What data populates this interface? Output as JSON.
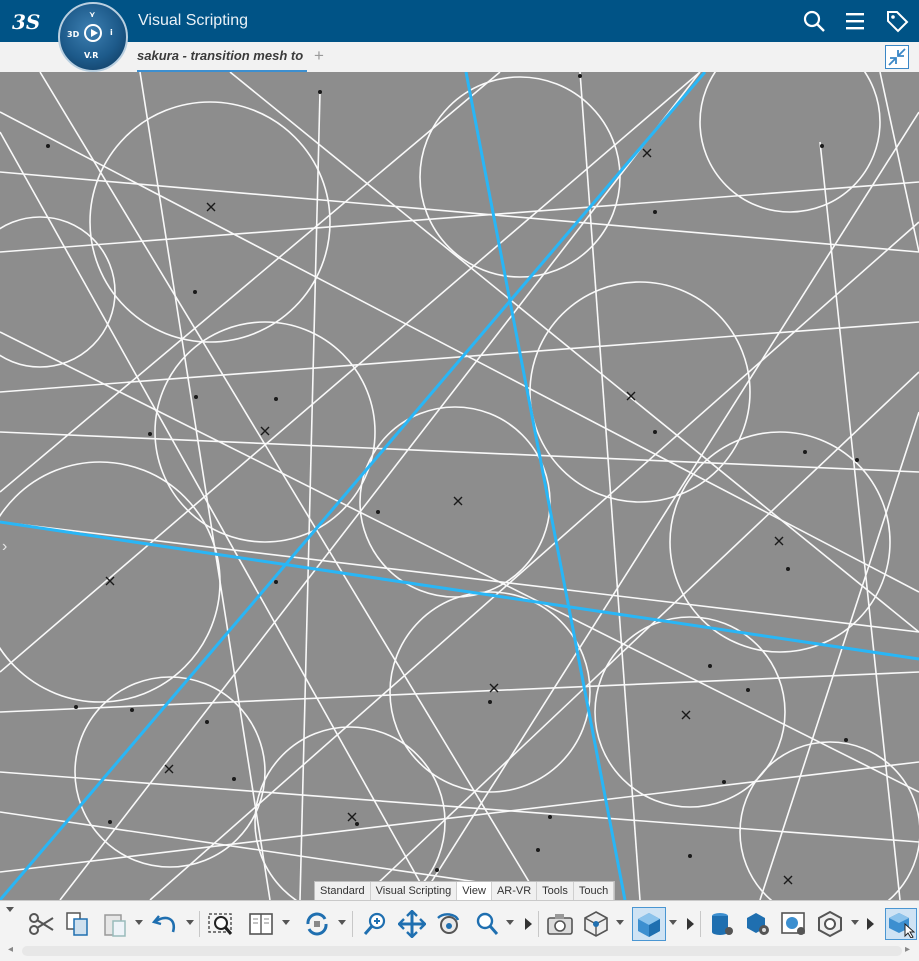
{
  "app": {
    "title": "Visual Scripting",
    "brand_logo": "3DS",
    "compass": {
      "top": "3D",
      "bottom": "V.R",
      "left": "3D",
      "right": "i"
    }
  },
  "header": {
    "icons": [
      "search-icon",
      "menu-icon",
      "tag-icon"
    ]
  },
  "tabs": {
    "document_tab": "sakura - transition mesh to",
    "add_tab": "+"
  },
  "toolbar_tabs": [
    "Standard",
    "Visual Scripting",
    "View",
    "AR-VR",
    "Tools",
    "Touch"
  ],
  "toolbar_active_tab": "View",
  "toolbar_icons": [
    "cut-icon",
    "copy-icon",
    "paste-icon",
    "undo-icon",
    "zoom-fit-icon",
    "book-icon",
    "rotate-icon",
    "zoom-icon",
    "pan-icon",
    "look-at-icon",
    "zoom-in-out-icon",
    "camera-icon",
    "view-cube-icon",
    "shaded-icon",
    "database-icon",
    "settings-cube-icon",
    "render-icon",
    "hexagon-icon",
    "view-select-icon"
  ],
  "colors": {
    "header": "#005386",
    "accent": "#3c8fd0",
    "viewport": "#8d8d8d",
    "wire": "#ffffff",
    "highlight_wire": "#29b6f6"
  }
}
